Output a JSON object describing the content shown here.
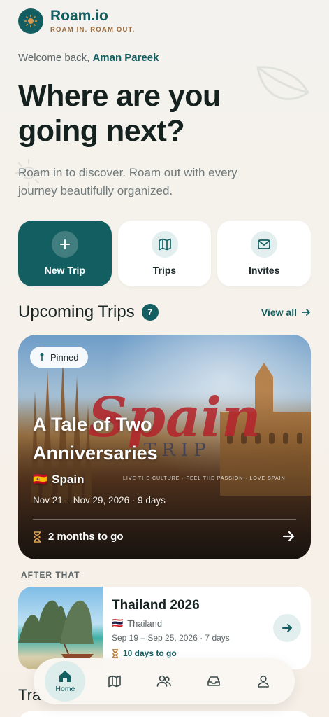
{
  "brand": {
    "name": "Roam.io",
    "tagline": "ROAM IN. ROAM OUT."
  },
  "welcome": {
    "prefix": "Welcome back, ",
    "user": "Aman Pareek"
  },
  "hero": {
    "title": "Where are you going next?",
    "subtitle": "Roam in to discover. Roam out with every journey beautifully organized."
  },
  "actions": [
    {
      "label": "New Trip",
      "icon": "plus-icon"
    },
    {
      "label": "Trips",
      "icon": "map-icon"
    },
    {
      "label": "Invites",
      "icon": "mail-icon"
    }
  ],
  "upcoming": {
    "title": "Upcoming Trips",
    "count": "7",
    "view_all": "View all"
  },
  "featured_trip": {
    "badge": "Pinned",
    "title": "A Tale of Two Anniversaries",
    "flag": "🇪🇸",
    "country": "Spain",
    "dates": "Nov 21 – Nov 29, 2026 · 9 days",
    "countdown": "2 months to go",
    "image_text": {
      "script": "Spain",
      "word": "TRIP",
      "tagline": "LIVE THE CULTURE · FEEL THE PASSION · LOVE SPAIN"
    }
  },
  "after_label": "AFTER THAT",
  "next_trip": {
    "title": "Thailand 2026",
    "flag": "🇹🇭",
    "country": "Thailand",
    "dates": "Sep 19 – Sep 25, 2026 · 7 days",
    "countdown": "10 days to go"
  },
  "travel_heading": "Tra",
  "nav": [
    {
      "label": "Home",
      "icon": "home-icon",
      "active": true
    },
    {
      "label": "",
      "icon": "map-icon"
    },
    {
      "label": "",
      "icon": "users-icon"
    },
    {
      "label": "",
      "icon": "inbox-icon"
    },
    {
      "label": "",
      "icon": "profile-icon"
    }
  ],
  "colors": {
    "primary": "#135e60",
    "accent": "#9a6b3a",
    "script_red": "#b3262c"
  }
}
